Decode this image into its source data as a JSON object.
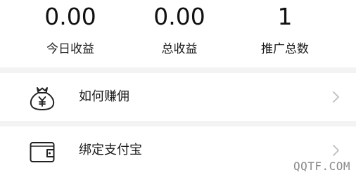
{
  "stats": [
    {
      "value": "0.00",
      "label": "今日收益"
    },
    {
      "value": "0.00",
      "label": "总收益"
    },
    {
      "value": "1",
      "label": "推广总数"
    }
  ],
  "menu": [
    {
      "label": "如何赚佣",
      "icon": "money-bag-icon"
    },
    {
      "label": "绑定支付宝",
      "icon": "wallet-icon"
    }
  ],
  "watermark": "QQTF.COM",
  "colors": {
    "separator": "#f3f3f3",
    "chevron": "#bdbdbd",
    "icon": "#222222"
  }
}
